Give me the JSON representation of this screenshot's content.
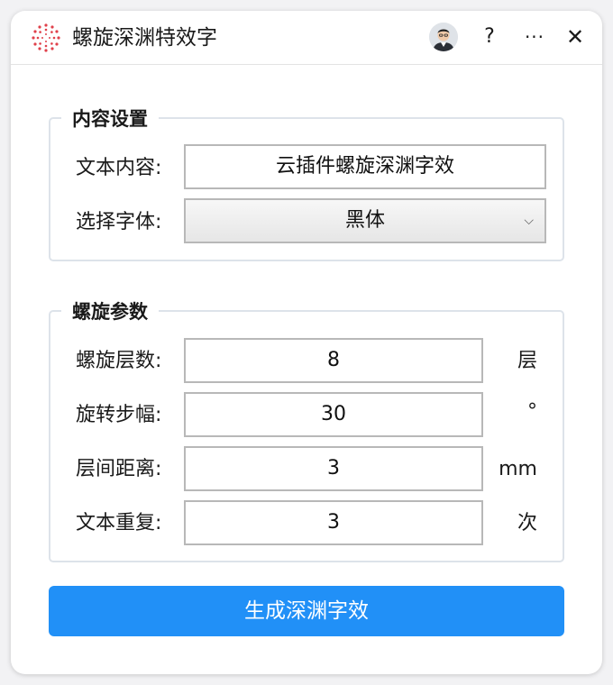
{
  "window": {
    "title": "螺旋深渊特效字",
    "buttons": {
      "help": "?",
      "more": "···",
      "close": "✕"
    }
  },
  "content_group": {
    "legend": "内容设置",
    "text_label": "文本内容:",
    "text_value": "云插件螺旋深渊字效",
    "font_label": "选择字体:",
    "font_value": "黑体"
  },
  "spiral_group": {
    "legend": "螺旋参数",
    "rows": [
      {
        "label": "螺旋层数:",
        "value": "8",
        "unit": "层"
      },
      {
        "label": "旋转步幅:",
        "value": "30",
        "unit": "°"
      },
      {
        "label": "层间距离:",
        "value": "3",
        "unit": "mm"
      },
      {
        "label": "文本重复:",
        "value": "3",
        "unit": "次"
      }
    ]
  },
  "generate_button": {
    "label": "生成深渊字效"
  },
  "colors": {
    "accent": "#2190f7",
    "border": "#dde3ea",
    "logo": "#e0404a"
  }
}
